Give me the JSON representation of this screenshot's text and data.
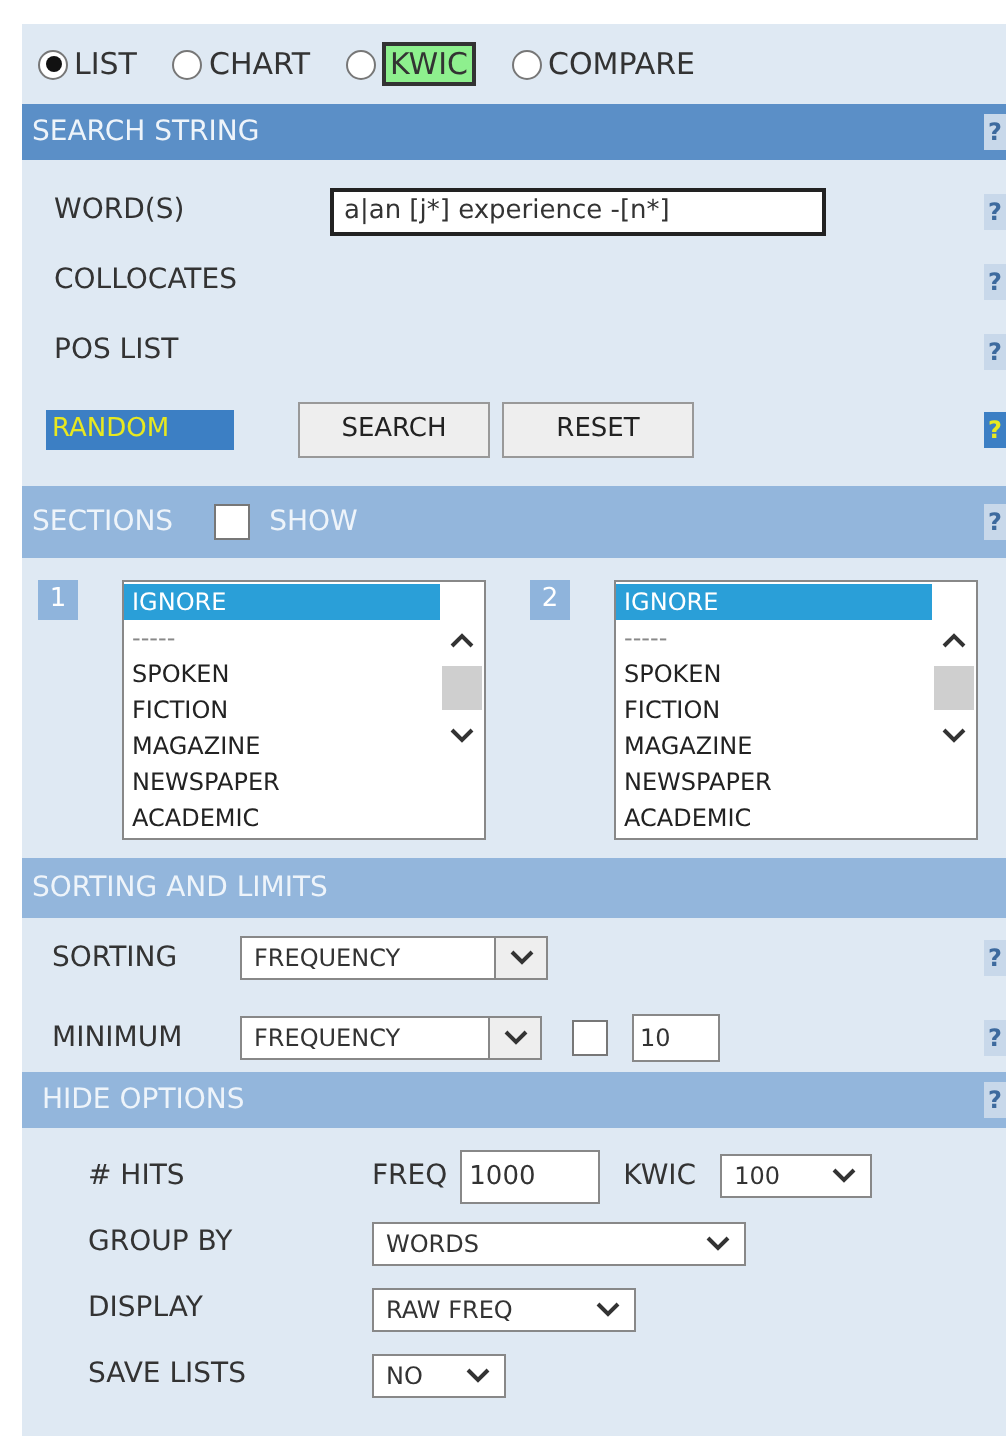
{
  "modes": [
    {
      "label": "LIST",
      "selected": true,
      "highlighted": false
    },
    {
      "label": "CHART",
      "selected": false,
      "highlighted": false
    },
    {
      "label": "KWIC",
      "selected": false,
      "highlighted": true
    },
    {
      "label": "COMPARE",
      "selected": false,
      "highlighted": false
    }
  ],
  "search_string": {
    "title": "SEARCH STRING",
    "help": "?",
    "rows": [
      {
        "kind": "field",
        "label": "WORD(S)",
        "value": "a|an [j*] experience -[n*]",
        "help": "?"
      },
      {
        "kind": "label",
        "label": "COLLOCATES",
        "help": "?"
      },
      {
        "kind": "label",
        "label": "POS LIST",
        "help": "?"
      },
      {
        "kind": "actions",
        "label": "RANDOM",
        "buttons": [
          "SEARCH",
          "RESET"
        ],
        "help": "?"
      }
    ]
  },
  "sections": {
    "title": "SECTIONS",
    "show": {
      "label": "SHOW",
      "checked": false
    },
    "help": "?",
    "lists": [
      {
        "number": "1",
        "items": [
          {
            "label": "IGNORE",
            "selected": true
          },
          {
            "label": "-----",
            "selected": false
          },
          {
            "label": "SPOKEN",
            "selected": false
          },
          {
            "label": "FICTION",
            "selected": false
          },
          {
            "label": "MAGAZINE",
            "selected": false
          },
          {
            "label": "NEWSPAPER",
            "selected": false
          },
          {
            "label": "ACADEMIC",
            "selected": false
          }
        ]
      },
      {
        "number": "2",
        "items": [
          {
            "label": "IGNORE",
            "selected": true
          },
          {
            "label": "-----",
            "selected": false
          },
          {
            "label": "SPOKEN",
            "selected": false
          },
          {
            "label": "FICTION",
            "selected": false
          },
          {
            "label": "MAGAZINE",
            "selected": false
          },
          {
            "label": "NEWSPAPER",
            "selected": false
          },
          {
            "label": "ACADEMIC",
            "selected": false
          }
        ]
      }
    ]
  },
  "sorting": {
    "title": "SORTING AND LIMITS",
    "rows": [
      {
        "kind": "sort",
        "label": "SORTING",
        "select": "FREQUENCY",
        "help": "?"
      },
      {
        "kind": "minimum",
        "label": "MINIMUM",
        "select": "FREQUENCY",
        "checked": false,
        "value": "10",
        "help": "?"
      }
    ]
  },
  "hide_options": {
    "title": "HIDE OPTIONS",
    "help": "?",
    "hits": {
      "label": "# HITS",
      "freq_label": "FREQ",
      "freq_value": "1000",
      "kwic_label": "KWIC",
      "kwic_value": "100"
    },
    "rows": [
      {
        "label": "GROUP BY",
        "value": "WORDS"
      },
      {
        "label": "DISPLAY",
        "value": "RAW FREQ"
      },
      {
        "label": "SAVE LISTS",
        "value": "NO"
      }
    ]
  }
}
